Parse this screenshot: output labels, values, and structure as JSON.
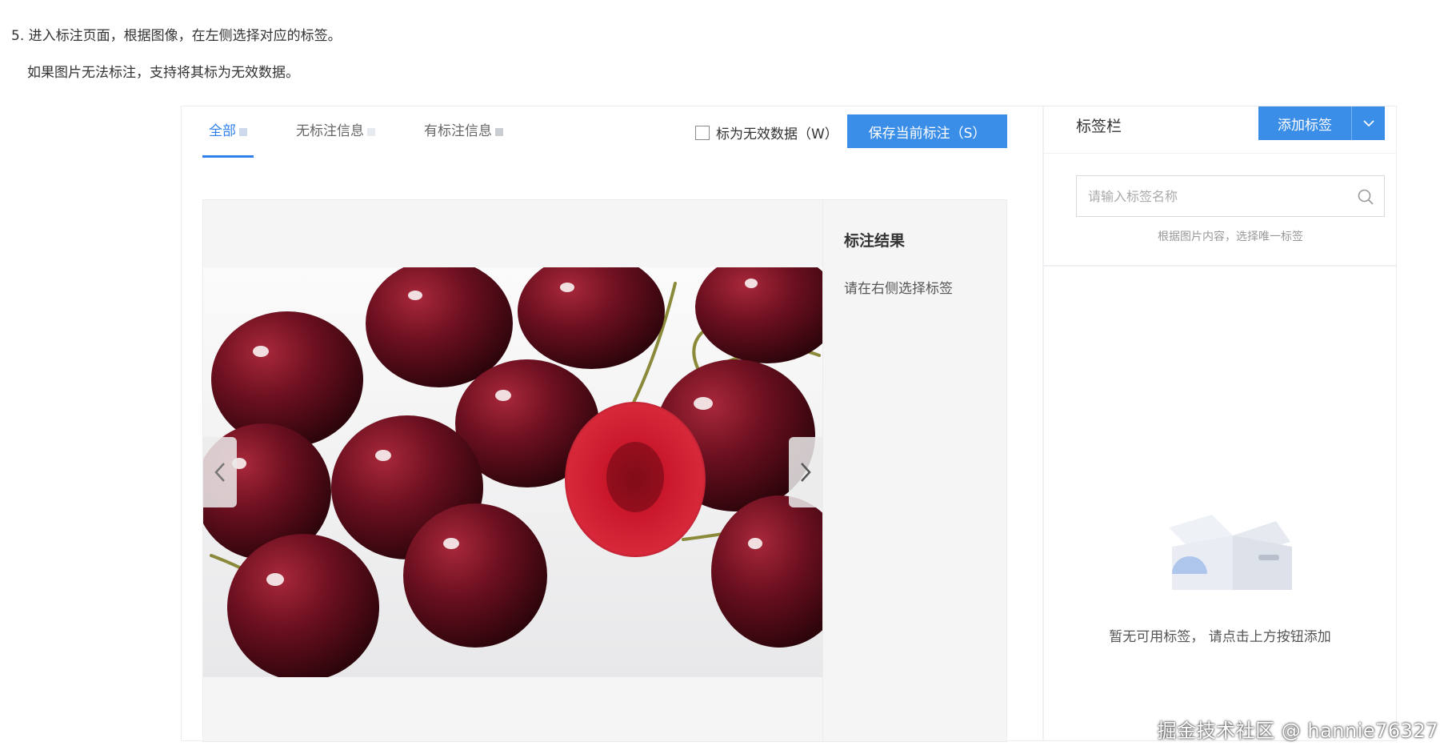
{
  "doc": {
    "line1": "5. 进入标注页面，根据图像，在左侧选择对应的标签。",
    "line2": "如果图片无法标注，支持将其标为无效数据。"
  },
  "tabs": [
    {
      "label": "全部",
      "active": true
    },
    {
      "label": "无标注信息",
      "active": false
    },
    {
      "label": "有标注信息",
      "active": false
    }
  ],
  "toolbar": {
    "invalid_label": "标为无效数据（W）",
    "save_label": "保存当前标注（S）"
  },
  "result": {
    "title": "标注结果",
    "hint": "请在右侧选择标签"
  },
  "tag_panel": {
    "title": "标签栏",
    "add_label": "添加标签",
    "search_placeholder": "请输入标签名称",
    "helper": "根据图片内容，选择唯一标签",
    "empty_text": "暂无可用标签， 请点击上方按钮添加"
  },
  "colors": {
    "accent": "#3b8ee8",
    "cherry": "#5a0d1a",
    "cherry_cut": "#c8172a"
  },
  "icons": {
    "prev": "chevron-left-icon",
    "next": "chevron-right-icon",
    "dropdown": "chevron-down-icon",
    "search": "search-icon",
    "empty": "empty-box-icon"
  },
  "watermark": "掘金技术社区 @ hannie76327"
}
